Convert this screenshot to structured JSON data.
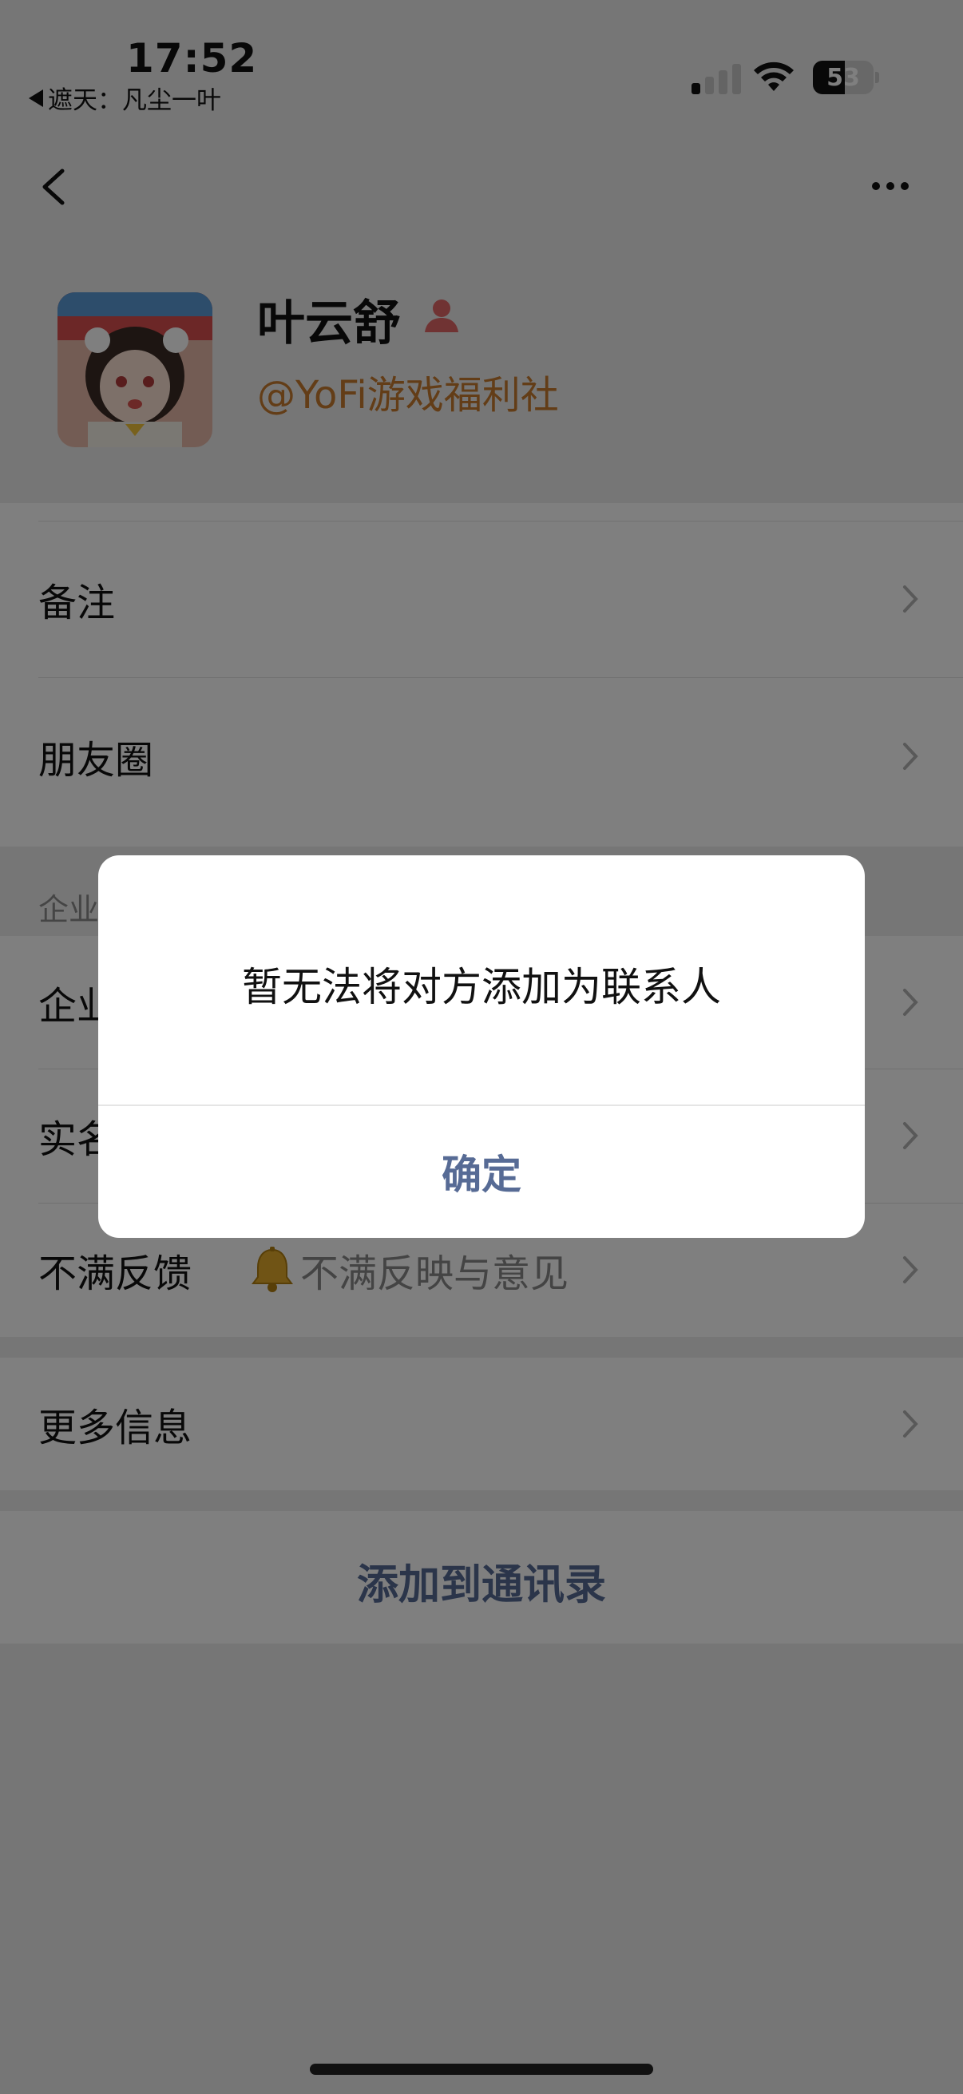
{
  "status_bar": {
    "time": "17:52",
    "back_app_label": "遮天：凡尘一叶",
    "battery": "53",
    "battery_fill_percent": 53,
    "signal_bars_on": 1,
    "signal_bars_total": 4
  },
  "profile": {
    "name": "叶云舒",
    "company": "@YoFi游戏福利社",
    "company_color": "#c77a2e"
  },
  "rows": [
    {
      "label": "备注",
      "value": ""
    },
    {
      "label": "朋友圈",
      "value": ""
    }
  ],
  "enterprise_section": {
    "header": "企业",
    "rows": [
      {
        "label": "企业",
        "value": ""
      },
      {
        "label": "实名",
        "value": ""
      },
      {
        "label": "不满反馈",
        "value": "不满反映与意见"
      }
    ]
  },
  "more_info_label": "更多信息",
  "add_contact_label": "添加到通讯录",
  "dialog": {
    "message": "暂无法将对方添加为联系人",
    "confirm_label": "确定"
  },
  "colors": {
    "link_blue": "#576b95",
    "mask": "rgba(0,0,0,0.5)"
  }
}
